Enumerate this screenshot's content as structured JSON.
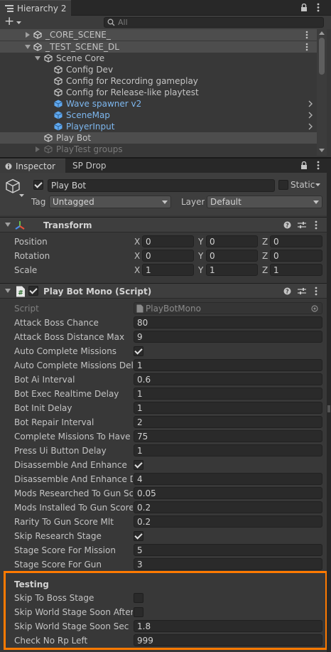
{
  "hierarchy": {
    "tab_label": "Hierarchy 2",
    "search_placeholder": "All",
    "add_label": "+",
    "items": [
      {
        "label": "_CORE_SCENE_",
        "kind": "scene"
      },
      {
        "label": "_TEST_SCENE_DL",
        "kind": "scene"
      },
      {
        "label": "Scene Core",
        "kind": "object"
      },
      {
        "label": "Config Dev",
        "kind": "object"
      },
      {
        "label": "Config for Recording gameplay",
        "kind": "object"
      },
      {
        "label": "Config for Release-like playtest",
        "kind": "object"
      },
      {
        "label": "Wave spawner v2",
        "kind": "prefab"
      },
      {
        "label": "SceneMap",
        "kind": "prefab"
      },
      {
        "label": "PlayerInput",
        "kind": "prefab"
      },
      {
        "label": "Play Bot",
        "kind": "selected"
      },
      {
        "label": "PlayTest groups",
        "kind": "disabled"
      }
    ]
  },
  "inspector": {
    "tabs": [
      "Inspector",
      "SP Drop"
    ],
    "object_name": "Play Bot",
    "static_label": "Static",
    "tag_label": "Tag",
    "tag_value": "Untagged",
    "layer_label": "Layer",
    "layer_value": "Default"
  },
  "transform": {
    "title": "Transform",
    "rows": [
      {
        "label": "Position",
        "x": "0",
        "y": "0",
        "z": "0"
      },
      {
        "label": "Rotation",
        "x": "0",
        "y": "0",
        "z": "0"
      },
      {
        "label": "Scale",
        "x": "1",
        "y": "1",
        "z": "1"
      }
    ],
    "axis_labels": [
      "X",
      "Y",
      "Z"
    ]
  },
  "script_component": {
    "title": "Play Bot Mono (Script)",
    "script_label": "Script",
    "script_value": "PlayBotMono",
    "fields": [
      {
        "label": "Attack Boss Chance",
        "type": "value",
        "value": "80"
      },
      {
        "label": "Attack Boss Distance Max",
        "type": "value",
        "value": "9"
      },
      {
        "label": "Auto Complete Missions",
        "type": "check",
        "checked": true
      },
      {
        "label": "Auto Complete Missions Delay",
        "type": "value",
        "value": "1"
      },
      {
        "label": "Bot Ai Interval",
        "type": "value",
        "value": "0.6"
      },
      {
        "label": "Bot Exec Realtime Delay",
        "type": "value",
        "value": "1"
      },
      {
        "label": "Bot Init Delay",
        "type": "value",
        "value": "1"
      },
      {
        "label": "Bot Repair Interval",
        "type": "value",
        "value": "2"
      },
      {
        "label": "Complete Missions To Have R",
        "type": "value",
        "value": "75"
      },
      {
        "label": "Press Ui Button Delay",
        "type": "value",
        "value": "1"
      },
      {
        "label": "Disassemble And Enhance",
        "type": "check",
        "checked": true
      },
      {
        "label": "Disassemble And Enhance De",
        "type": "value",
        "value": "4"
      },
      {
        "label": "Mods Researched To Gun Scc",
        "type": "value",
        "value": "0.05"
      },
      {
        "label": "Mods Installed To Gun Score I",
        "type": "value",
        "value": "0.2"
      },
      {
        "label": "Rarity To Gun Score Mlt",
        "type": "value",
        "value": "0.2"
      },
      {
        "label": "Skip Research Stage",
        "type": "check",
        "checked": true
      },
      {
        "label": "Stage Score For Mission",
        "type": "value",
        "value": "5"
      },
      {
        "label": "Stage Score For Gun",
        "type": "value",
        "value": "3"
      }
    ],
    "testing_header": "Testing",
    "testing_fields": [
      {
        "label": "Skip To Boss Stage",
        "type": "check",
        "checked": false
      },
      {
        "label": "Skip World Stage Soon After S",
        "type": "check",
        "checked": false
      },
      {
        "label": "Skip World Stage Soon Sec",
        "type": "value",
        "value": "1.8"
      },
      {
        "label": "Check No Rp Left",
        "type": "value",
        "value": "999"
      }
    ]
  },
  "colors": {
    "highlight": "#ff7a00",
    "prefab_blue": "#7db7ef",
    "background": "#383838"
  }
}
